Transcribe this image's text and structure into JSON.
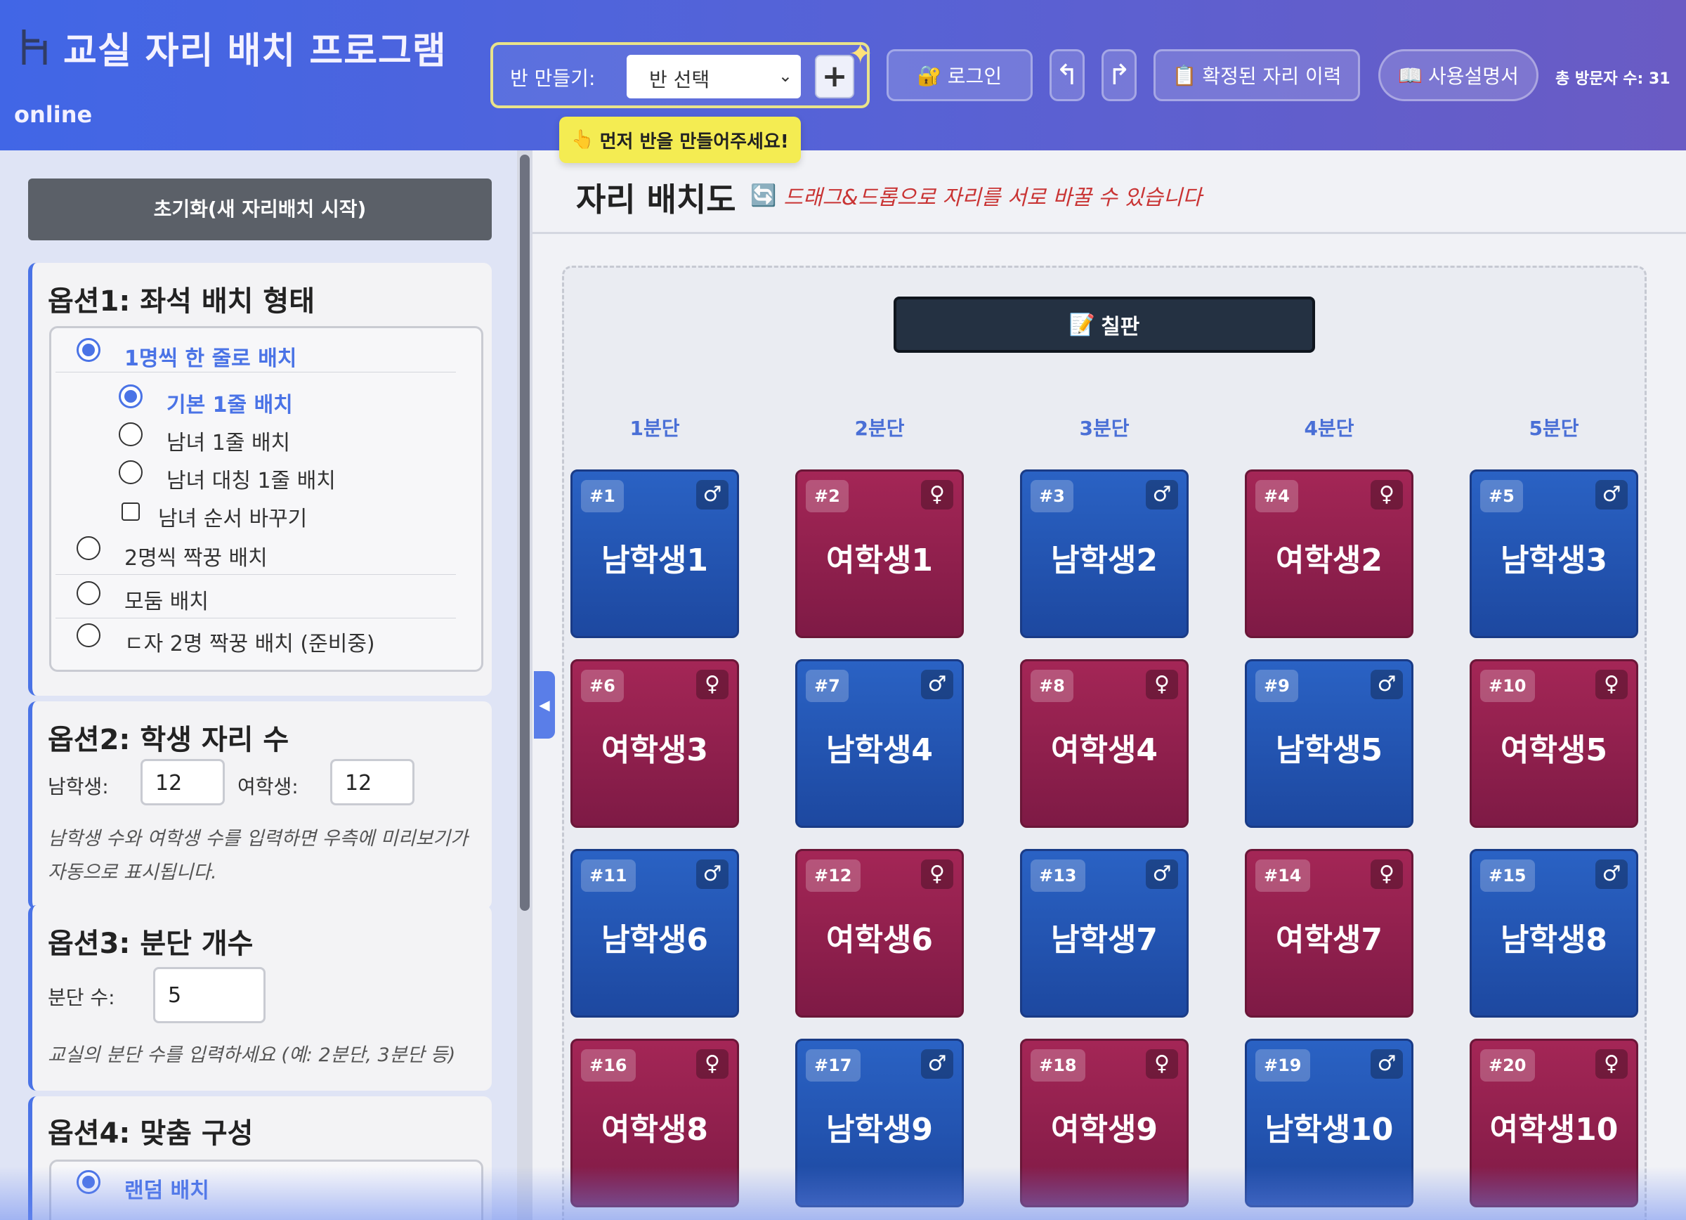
{
  "header": {
    "title": "교실 자리 배치 프로그램",
    "status": "online",
    "class_label": "반 만들기:",
    "class_select": "반 선택",
    "add": "+",
    "login": "로그인",
    "undo": "↰",
    "redo": "↱",
    "history": "확정된 자리 이력",
    "manual": "사용설명서",
    "visitors": "총 방문자 수: 31",
    "tooltip": "먼저 반을 만들어주세요!"
  },
  "sidebar": {
    "reset": "초기화(새 자리배치 시작)",
    "option1": {
      "title": "옵션1: 좌석 배치 형태",
      "single_row": "1명씩 한 줄로 배치",
      "basic": "기본 1줄 배치",
      "gender_row": "남녀 1줄 배치",
      "gender_sym": "남녀 대칭 1줄 배치",
      "swap_order": "남녀 순서 바꾸기",
      "pairs": "2명씩 짝꿍 배치",
      "group": "모둠 배치",
      "u_shape": "ㄷ자 2명 짝꿍 배치 (준비중)"
    },
    "option2": {
      "title": "옵션2: 학생 자리 수",
      "male_label": "남학생:",
      "male": "12",
      "female_label": "여학생:",
      "female": "12",
      "hint": "남학생 수와 여학생 수를 입력하면 우측에 미리보기가 자동으로 표시됩니다."
    },
    "option3": {
      "title": "옵션3: 분단 개수",
      "label": "분단 수:",
      "value": "5",
      "hint": "교실의 분단 수를 입력하세요 (예: 2분단, 3분단 등)"
    },
    "option4": {
      "title": "옵션4: 맞춤 구성",
      "random": "랜덤 배치"
    }
  },
  "main": {
    "title": "자리 배치도",
    "hint": "드래그&드롭으로 자리를 서로 바꿀 수 있습니다",
    "blackboard": "칠판",
    "columns": [
      "1분단",
      "2분단",
      "3분단",
      "4분단",
      "5분단"
    ],
    "seats": [
      {
        "num": "#1",
        "name": "남학생1",
        "g": "m"
      },
      {
        "num": "#2",
        "name": "여학생1",
        "g": "f"
      },
      {
        "num": "#3",
        "name": "남학생2",
        "g": "m"
      },
      {
        "num": "#4",
        "name": "여학생2",
        "g": "f"
      },
      {
        "num": "#5",
        "name": "남학생3",
        "g": "m"
      },
      {
        "num": "#6",
        "name": "여학생3",
        "g": "f"
      },
      {
        "num": "#7",
        "name": "남학생4",
        "g": "m"
      },
      {
        "num": "#8",
        "name": "여학생4",
        "g": "f"
      },
      {
        "num": "#9",
        "name": "남학생5",
        "g": "m"
      },
      {
        "num": "#10",
        "name": "여학생5",
        "g": "f"
      },
      {
        "num": "#11",
        "name": "남학생6",
        "g": "m"
      },
      {
        "num": "#12",
        "name": "여학생6",
        "g": "f"
      },
      {
        "num": "#13",
        "name": "남학생7",
        "g": "m"
      },
      {
        "num": "#14",
        "name": "여학생7",
        "g": "f"
      },
      {
        "num": "#15",
        "name": "남학생8",
        "g": "m"
      },
      {
        "num": "#16",
        "name": "여학생8",
        "g": "f"
      },
      {
        "num": "#17",
        "name": "남학생9",
        "g": "m"
      },
      {
        "num": "#18",
        "name": "여학생9",
        "g": "f"
      },
      {
        "num": "#19",
        "name": "남학생10",
        "g": "m"
      },
      {
        "num": "#20",
        "name": "여학생10",
        "g": "f"
      }
    ]
  },
  "colors": {
    "male": "#2a62c4",
    "female": "#a42656",
    "accent": "#4a73e6",
    "tooltip": "#f4ec52"
  },
  "icons": {
    "male": "♂",
    "female": "♀"
  }
}
